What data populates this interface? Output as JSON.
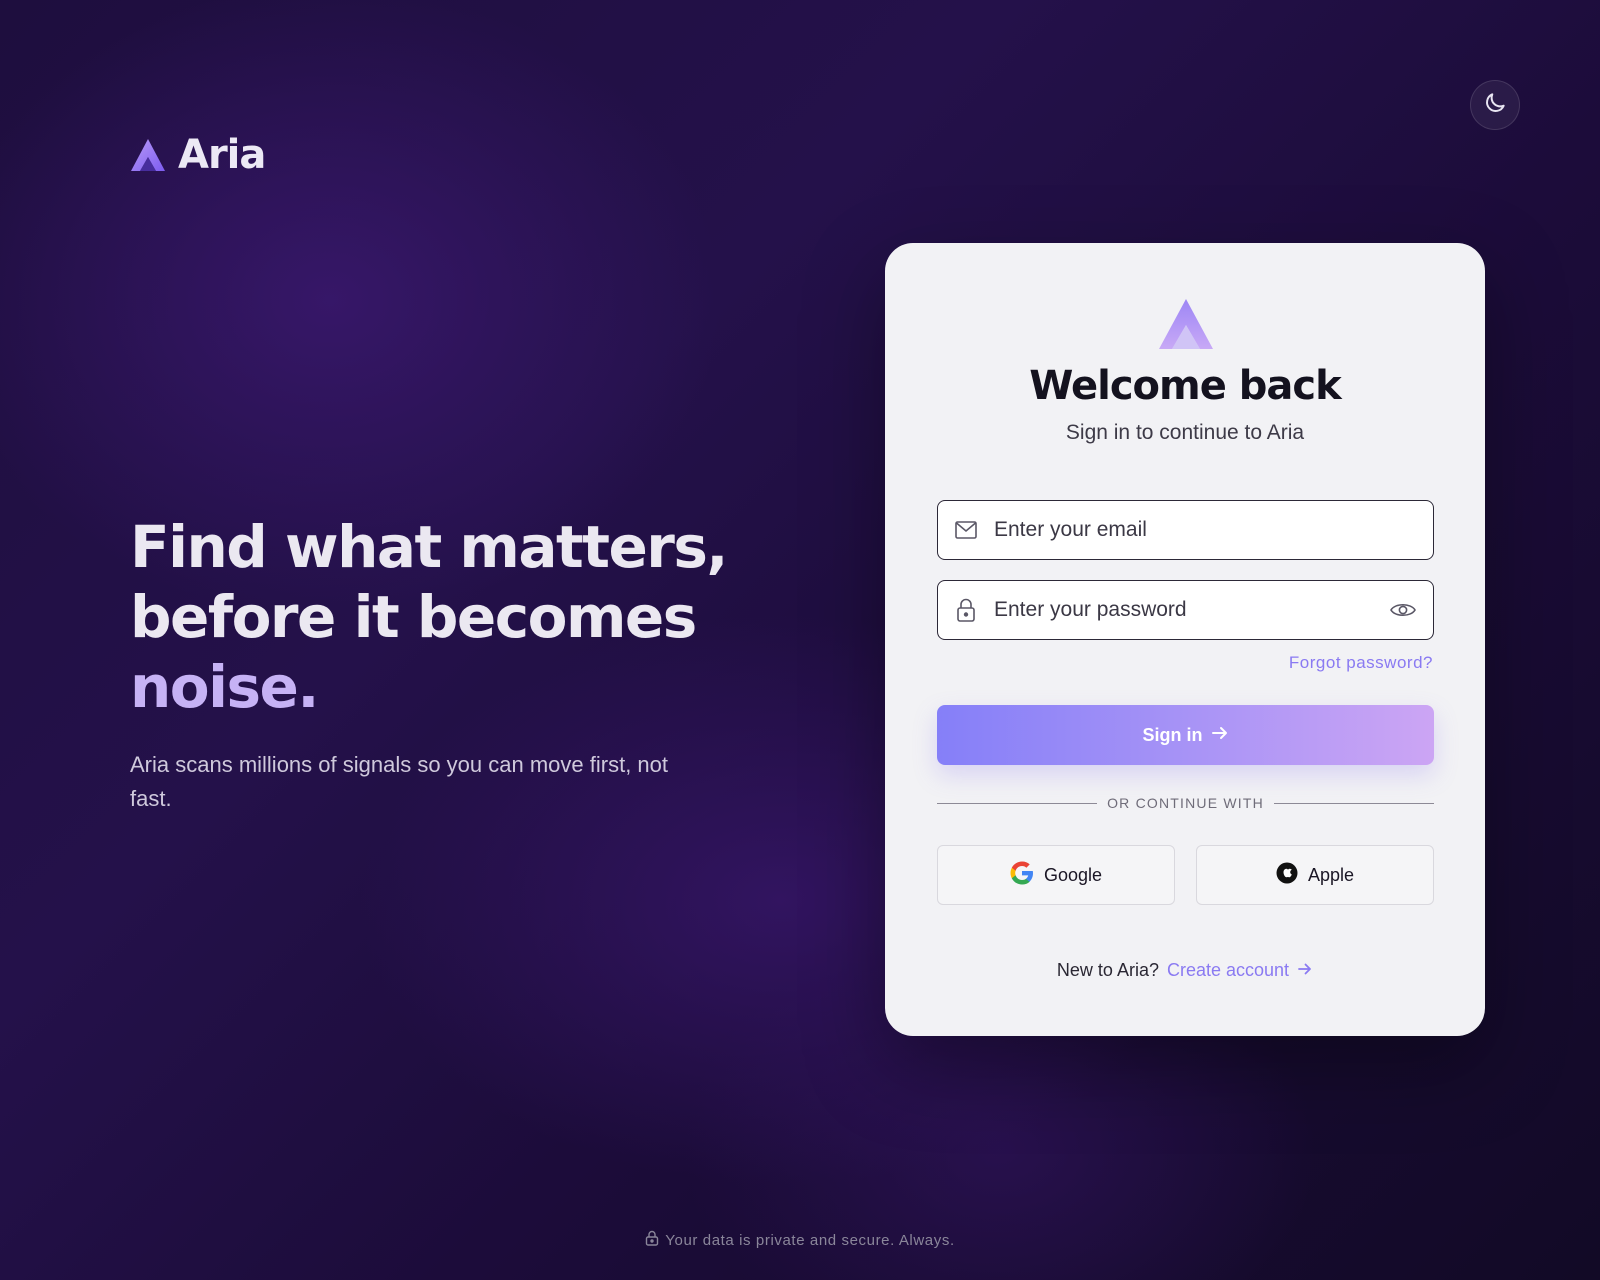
{
  "brand": {
    "name": "Aria",
    "logo_icon": "aria-triangle-logo"
  },
  "theme_toggle": {
    "icon": "moon-icon"
  },
  "hero": {
    "headline_line1": "Find what matters,",
    "headline_line2": "before it becomes",
    "headline_accent": "noise.",
    "subtext": "Aria scans millions of signals so you can move first, not fast."
  },
  "card": {
    "title": "Welcome back",
    "subtitle": "Sign in to continue to Aria",
    "email": {
      "placeholder": "Enter your email",
      "value": "",
      "icon": "mail-icon"
    },
    "password": {
      "placeholder": "Enter your password",
      "value": "",
      "icon": "lock-icon",
      "toggle_icon": "eye-icon"
    },
    "forgot_label": "Forgot password?",
    "signin_label": "Sign in",
    "divider_label": "OR CONTINUE WITH",
    "google_label": "Google",
    "apple_label": "Apple",
    "signup_prompt": "New to Aria?",
    "signup_link": "Create account"
  },
  "footer": {
    "text": "Your data is private and secure. Always."
  },
  "colors": {
    "accent": "#8a7af2",
    "headline_accent": "#c6b2f5",
    "card_bg": "#f2f2f5",
    "signin_gradient_start": "#857ff8",
    "signin_gradient_end": "#cca5f4"
  }
}
